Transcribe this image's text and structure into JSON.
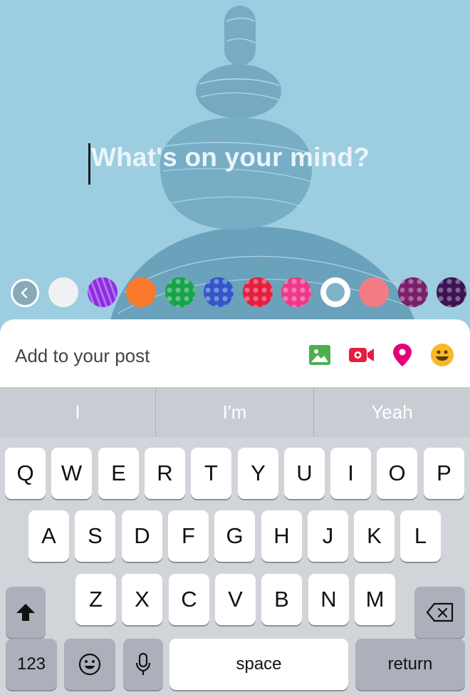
{
  "composer": {
    "placeholder": "What's on your mind?"
  },
  "picker": {
    "back_icon": "chevron-left-icon",
    "swatches": [
      {
        "name": "white",
        "color": "#f0f1f3",
        "pattern": "none"
      },
      {
        "name": "purple",
        "color": "#8d2be3",
        "pattern": "stripes"
      },
      {
        "name": "orange",
        "color": "#fa7a2d",
        "pattern": "none"
      },
      {
        "name": "green",
        "color": "#16a34a",
        "pattern": "dots"
      },
      {
        "name": "blue",
        "color": "#3257c9",
        "pattern": "dots"
      },
      {
        "name": "red",
        "color": "#e51e3f",
        "pattern": "dots"
      },
      {
        "name": "pink",
        "color": "#f0388a",
        "pattern": "dots"
      },
      {
        "name": "selected-blue",
        "color": "#7fb3c9",
        "pattern": "ring"
      },
      {
        "name": "salmon",
        "color": "#f37c84",
        "pattern": "none"
      },
      {
        "name": "plum",
        "color": "#7a1f6c",
        "pattern": "dots"
      },
      {
        "name": "dark-purple",
        "color": "#3c1455",
        "pattern": "dots"
      }
    ]
  },
  "add_to_post": {
    "label": "Add to your post",
    "icons": [
      {
        "name": "photo-icon",
        "color": "#4caf50"
      },
      {
        "name": "video-camera-icon",
        "color": "#e41e3f"
      },
      {
        "name": "location-pin-icon",
        "color": "#e4007c"
      },
      {
        "name": "emoji-icon",
        "color": "#f7b928"
      }
    ]
  },
  "suggestions": [
    "I",
    "I'm",
    "Yeah"
  ],
  "keyboard": {
    "row1": [
      "Q",
      "W",
      "E",
      "R",
      "T",
      "Y",
      "U",
      "I",
      "O",
      "P"
    ],
    "row2": [
      "A",
      "S",
      "D",
      "F",
      "G",
      "H",
      "J",
      "K",
      "L"
    ],
    "row3": [
      "Z",
      "X",
      "C",
      "V",
      "B",
      "N",
      "M"
    ],
    "numbers_label": "123",
    "space_label": "space",
    "return_label": "return"
  }
}
